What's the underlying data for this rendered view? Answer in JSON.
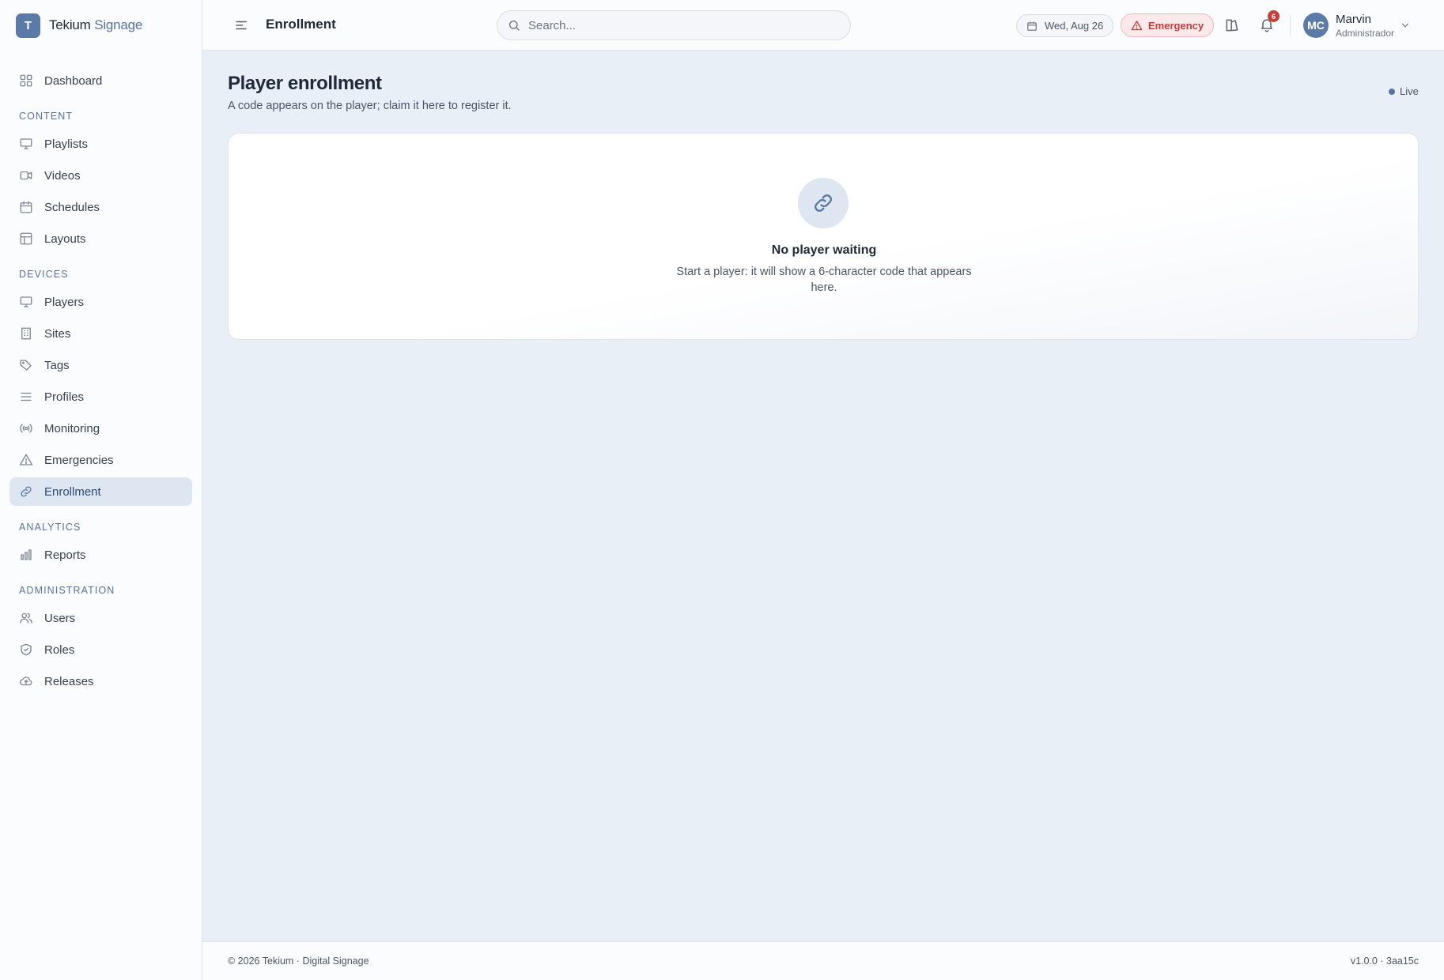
{
  "brand": {
    "logo_letter": "T",
    "name": "Tekium",
    "name_accent": "Signage"
  },
  "sidebar": {
    "dashboard": {
      "label": "Dashboard",
      "icon": "grid-icon"
    },
    "sections": [
      {
        "title": "CONTENT",
        "items": [
          {
            "label": "Playlists",
            "icon": "monitor-icon"
          },
          {
            "label": "Videos",
            "icon": "video-icon"
          },
          {
            "label": "Schedules",
            "icon": "calendar-icon"
          },
          {
            "label": "Layouts",
            "icon": "layout-icon"
          }
        ]
      },
      {
        "title": "DEVICES",
        "items": [
          {
            "label": "Players",
            "icon": "monitor-icon"
          },
          {
            "label": "Sites",
            "icon": "building-icon"
          },
          {
            "label": "Tags",
            "icon": "tag-icon"
          },
          {
            "label": "Profiles",
            "icon": "lines-icon"
          },
          {
            "label": "Monitoring",
            "icon": "broadcast-icon"
          },
          {
            "label": "Emergencies",
            "icon": "warning-icon"
          },
          {
            "label": "Enrollment",
            "icon": "link-icon",
            "active": true
          }
        ]
      },
      {
        "title": "ANALYTICS",
        "items": [
          {
            "label": "Reports",
            "icon": "bar-chart-icon"
          }
        ]
      },
      {
        "title": "ADMINISTRATION",
        "items": [
          {
            "label": "Users",
            "icon": "users-icon"
          },
          {
            "label": "Roles",
            "icon": "shield-icon"
          },
          {
            "label": "Releases",
            "icon": "cloud-upload-icon"
          }
        ]
      }
    ]
  },
  "header": {
    "title": "Enrollment",
    "search_placeholder": "Search...",
    "date": "Wed, Aug 26",
    "emergency_label": "Emergency",
    "notification_count": "6",
    "user": {
      "initials": "MC",
      "name": "Marvin",
      "role": "Administrador"
    }
  },
  "main": {
    "title": "Player enrollment",
    "subtitle": "A code appears on the player; claim it here to register it.",
    "status_label": "Live",
    "empty_state": {
      "title": "No player waiting",
      "text": "Start a player: it will show a 6-character code that appears here."
    }
  },
  "footer": {
    "left": "© 2026 Tekium · Digital Signage",
    "right": "v1.0.0 · 3aa15c"
  },
  "colors": {
    "accent": "#5b7aa7",
    "emergency": "#c53a3a",
    "badge": "#c5403b",
    "active_bg": "#dde6f1"
  }
}
